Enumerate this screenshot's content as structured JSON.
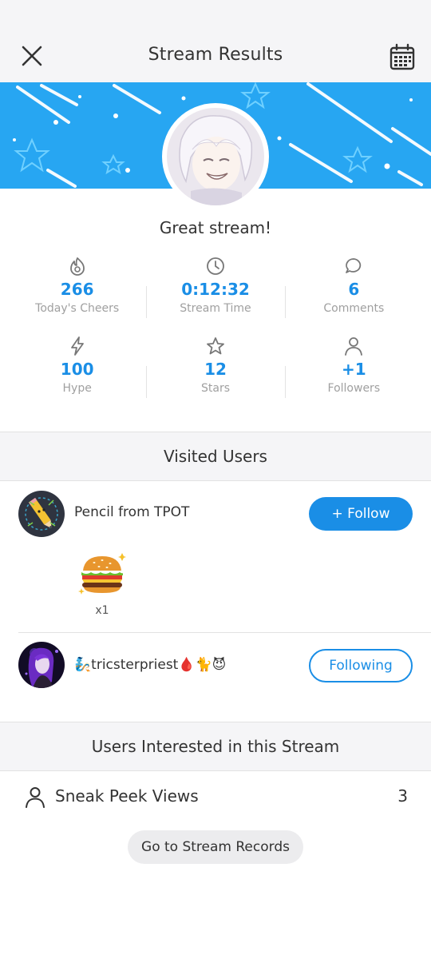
{
  "header": {
    "title": "Stream Results",
    "close_icon": "close-icon",
    "calendar_icon": "calendar-icon"
  },
  "summary": {
    "headline": "Great stream!"
  },
  "stats": [
    {
      "icon": "cheers-icon",
      "value": "266",
      "label": "Today's Cheers"
    },
    {
      "icon": "clock-icon",
      "value": "0:12:32",
      "label": "Stream Time"
    },
    {
      "icon": "comment-icon",
      "value": "6",
      "label": "Comments"
    },
    {
      "icon": "lightning-icon",
      "value": "100",
      "label": "Hype"
    },
    {
      "icon": "star-icon",
      "value": "12",
      "label": "Stars"
    },
    {
      "icon": "person-icon",
      "value": "+1",
      "label": "Followers"
    }
  ],
  "visited": {
    "title": "Visited Users",
    "users": [
      {
        "name": "Pencil from TPOT",
        "button": "+ Follow",
        "gift": {
          "icon": "burger-gift-icon",
          "count": "x1"
        }
      },
      {
        "name": "🧞tricsterpriest🩸🐈😈",
        "button": "Following"
      }
    ]
  },
  "interested": {
    "title": "Users Interested in this Stream",
    "sneak_label": "Sneak Peek Views",
    "sneak_count": "3"
  },
  "records_button": "Go to Stream Records",
  "colors": {
    "accent": "#1a8ee6",
    "banner": "#27a6f2",
    "section_bg": "#f5f5f7"
  }
}
